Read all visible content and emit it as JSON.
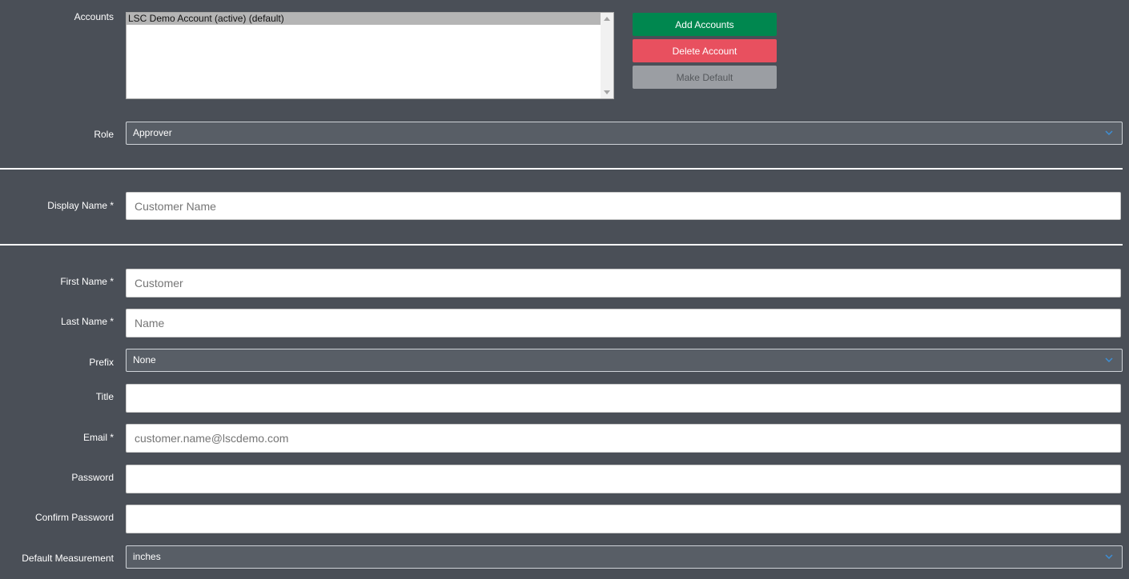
{
  "accounts": {
    "label": "Accounts",
    "options": [
      "LSC Demo Account (active) (default)"
    ],
    "buttons": {
      "add": "Add Accounts",
      "delete": "Delete Account",
      "make_default": "Make Default"
    }
  },
  "role": {
    "label": "Role",
    "value": "Approver"
  },
  "display_name": {
    "label": "Display Name *",
    "placeholder": "Customer Name"
  },
  "first_name": {
    "label": "First Name *",
    "placeholder": "Customer"
  },
  "last_name": {
    "label": "Last Name *",
    "placeholder": "Name"
  },
  "prefix": {
    "label": "Prefix",
    "value": "None"
  },
  "title": {
    "label": "Title",
    "placeholder": ""
  },
  "email": {
    "label": "Email *",
    "placeholder": "customer.name@lscdemo.com"
  },
  "password": {
    "label": "Password",
    "placeholder": ""
  },
  "confirm_password": {
    "label": "Confirm Password",
    "placeholder": ""
  },
  "default_measurement": {
    "label": "Default Measurement",
    "value": "inches"
  },
  "colors": {
    "background": "#4a4f57",
    "add_button": "#00874f",
    "delete_button": "#e8505f",
    "make_default_button": "#9b9ea3",
    "chevron": "#3d8fd6"
  },
  "icons": {
    "dropdown": "chevron-down-icon"
  }
}
